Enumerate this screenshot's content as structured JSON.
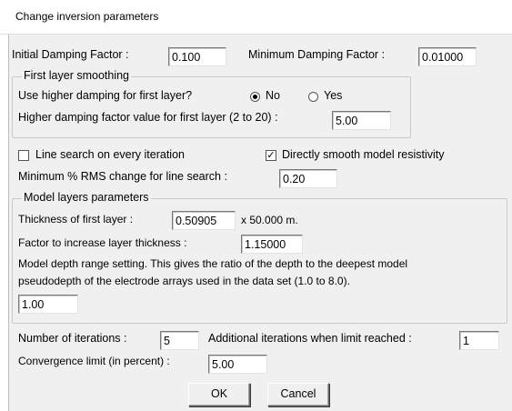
{
  "window": {
    "title": "Change inversion parameters"
  },
  "damping": {
    "initial_label": "Initial Damping Factor :",
    "initial_value": "0.100",
    "minimum_label": "Minimum Damping Factor :",
    "minimum_value": "0.01000"
  },
  "first_layer_smoothing": {
    "group_title": "First layer smoothing",
    "question": "Use higher damping for first layer?",
    "option_no": "No",
    "option_yes": "Yes",
    "selected": "No",
    "higher_factor_label": "Higher damping factor value for first layer (2 to 20) :",
    "higher_factor_value": "5.00"
  },
  "line_search": {
    "every_iteration_label": "Line search on every iteration",
    "every_iteration_checked": false,
    "smooth_resistivity_label": "Directly smooth model resistivity",
    "smooth_resistivity_checked": true,
    "min_rms_label": "Minimum % RMS change for line search :",
    "min_rms_value": "0.20"
  },
  "model_layers": {
    "group_title": "Model layers parameters",
    "thickness_label": "Thickness of first layer :",
    "thickness_value": "0.50905",
    "thickness_suffix": "x 50.000 m.",
    "factor_label": "Factor to increase layer thickness :",
    "factor_value": "1.15000",
    "depth_desc_line1": "Model depth range setting. This gives the ratio of the depth to the deepest model",
    "depth_desc_line2": "pseudodepth of the electrode arrays used in the data set (1.0 to 8.0).",
    "depth_value": "1.00"
  },
  "iterations": {
    "number_label": "Number of iterations :",
    "number_value": "5",
    "additional_label": "Additional iterations when limit reached :",
    "additional_value": "1",
    "convergence_label": "Convergence limit (in percent) :",
    "convergence_value": "5.00"
  },
  "buttons": {
    "ok": "OK",
    "cancel": "Cancel"
  }
}
